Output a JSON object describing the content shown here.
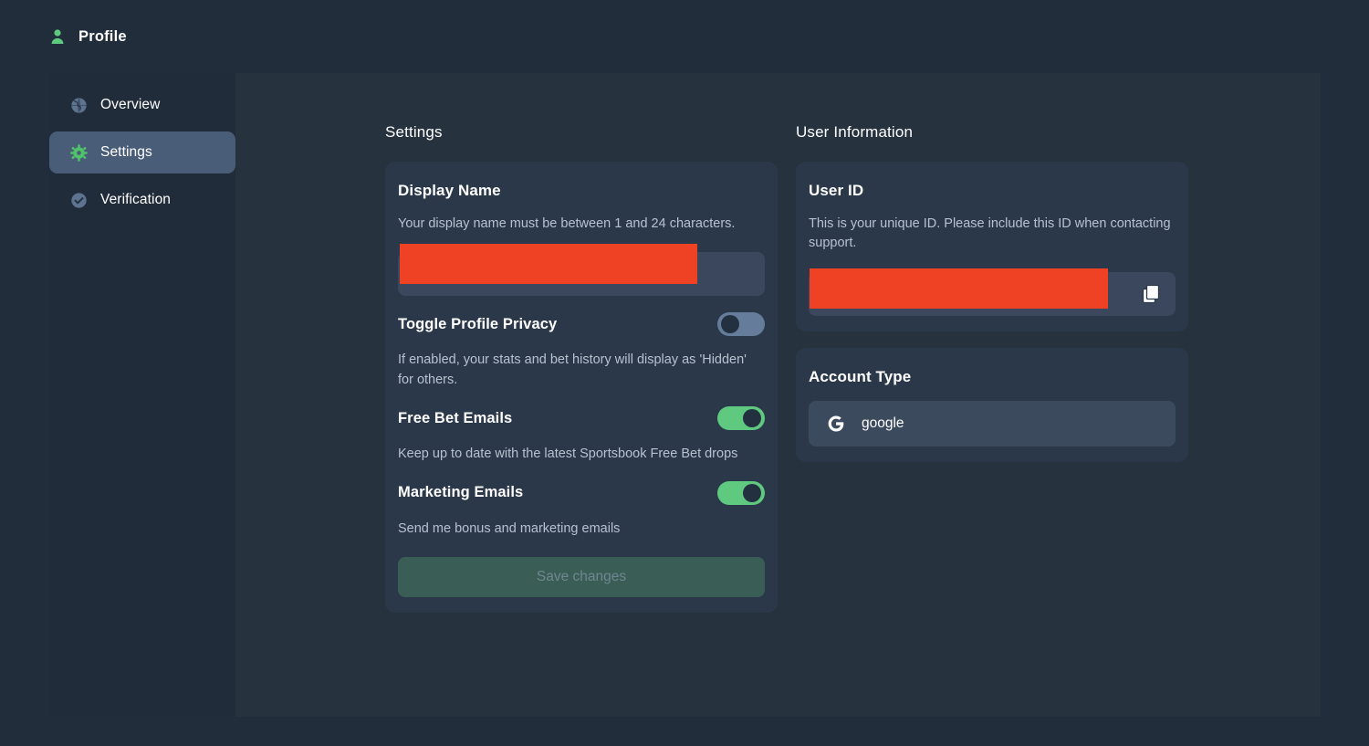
{
  "header": {
    "title": "Profile",
    "icon": "person-icon"
  },
  "sidebar": {
    "items": [
      {
        "label": "Overview",
        "icon": "globe-icon",
        "active": false
      },
      {
        "label": "Settings",
        "icon": "gear-icon",
        "active": true
      },
      {
        "label": "Verification",
        "icon": "check-circle-icon",
        "active": false
      }
    ]
  },
  "settings": {
    "section_title": "Settings",
    "display_name": {
      "title": "Display Name",
      "description": "Your display name must be between 1 and 24 characters.",
      "value": "",
      "redacted": true
    },
    "toggles": [
      {
        "label": "Toggle Profile Privacy",
        "state": "off",
        "description": "If enabled, your stats and bet history will display as 'Hidden' for others."
      },
      {
        "label": "Free Bet Emails",
        "state": "on",
        "description": "Keep up to date with the latest Sportsbook Free Bet drops"
      },
      {
        "label": "Marketing Emails",
        "state": "on",
        "description": "Send me bonus and marketing emails"
      }
    ],
    "save_button": {
      "label": "Save changes",
      "disabled": true
    }
  },
  "user_information": {
    "section_title": "User Information",
    "user_id": {
      "title": "User ID",
      "description": "This is your unique ID. Please include this ID when contacting support.",
      "value": "",
      "redacted": true,
      "copy_icon": "copy-icon"
    },
    "account_type": {
      "title": "Account Type",
      "provider": "google",
      "provider_icon": "google-g-icon"
    }
  },
  "colors": {
    "page_background": "#222d3b",
    "sidebar_background": "#212c3a",
    "content_background": "#27323f",
    "card_background": "#2b3849",
    "accent_green": "#5ec97f",
    "active_nav": "#4a5d78",
    "redaction_red": "#ef4123",
    "input_background": "#3a475c"
  }
}
